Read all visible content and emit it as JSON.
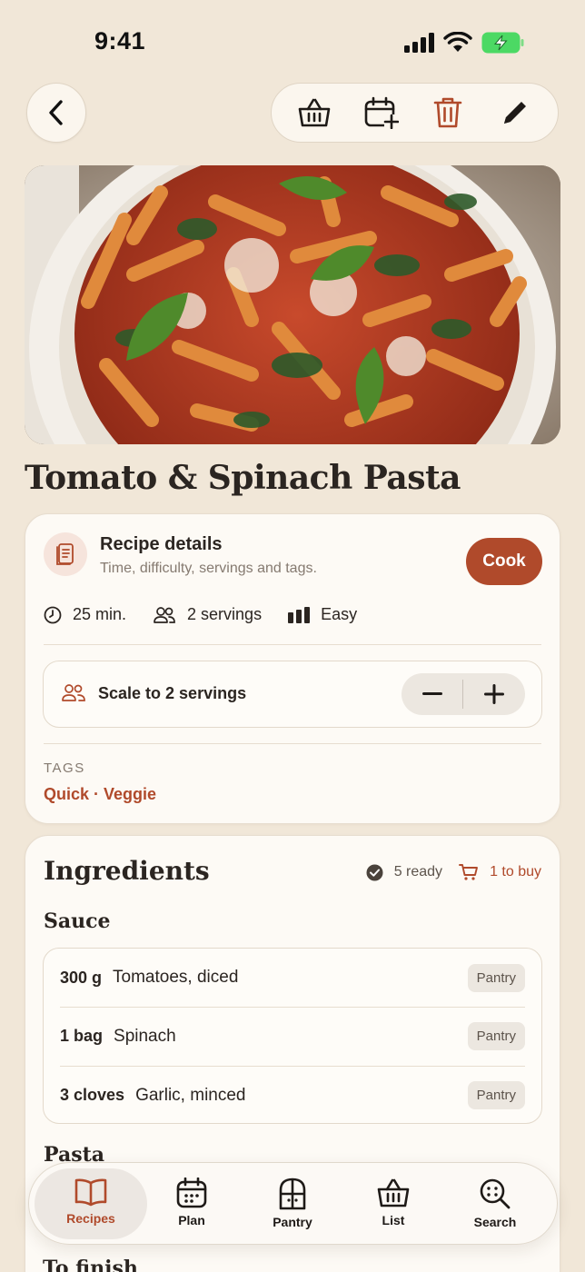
{
  "status_bar": {
    "time": "9:41"
  },
  "toolbar": {
    "back_icon": "chevron-left-icon",
    "actions": [
      "basket-icon",
      "calendar-add-icon",
      "trash-icon",
      "pencil-icon"
    ]
  },
  "recipe": {
    "title": "Tomato & Spinach Pasta"
  },
  "details": {
    "title": "Recipe details",
    "subtitle": "Time, difficulty, servings and tags.",
    "cook_label": "Cook",
    "time": "25 min.",
    "servings": "2 servings",
    "difficulty": "Easy",
    "scale_label": "Scale to 2 servings",
    "tags_label": "TAGS",
    "tags_value": "Quick · Veggie"
  },
  "ingredients": {
    "title": "Ingredients",
    "ready": "5 ready",
    "to_buy": "1 to buy",
    "sections": [
      {
        "title": "Sauce",
        "items": [
          {
            "qty": "300 g",
            "name": "Tomatoes, diced",
            "tag": "Pantry"
          },
          {
            "qty": "1 bag",
            "name": "Spinach",
            "tag": "Pantry"
          },
          {
            "qty": "3 cloves",
            "name": "Garlic, minced",
            "tag": "Pantry"
          }
        ]
      },
      {
        "title": "Pasta"
      },
      {
        "title": "To finish"
      }
    ]
  },
  "tabbar": {
    "tabs": [
      {
        "label": "Recipes",
        "icon": "book-icon",
        "active": true
      },
      {
        "label": "Plan",
        "icon": "calendar-icon"
      },
      {
        "label": "Pantry",
        "icon": "pantry-door-icon"
      },
      {
        "label": "List",
        "icon": "basket-icon"
      },
      {
        "label": "Search",
        "icon": "search-icon"
      }
    ]
  },
  "colors": {
    "accent": "#b04a2b",
    "background": "#f1e7d8",
    "card": "#fdfaf5"
  }
}
